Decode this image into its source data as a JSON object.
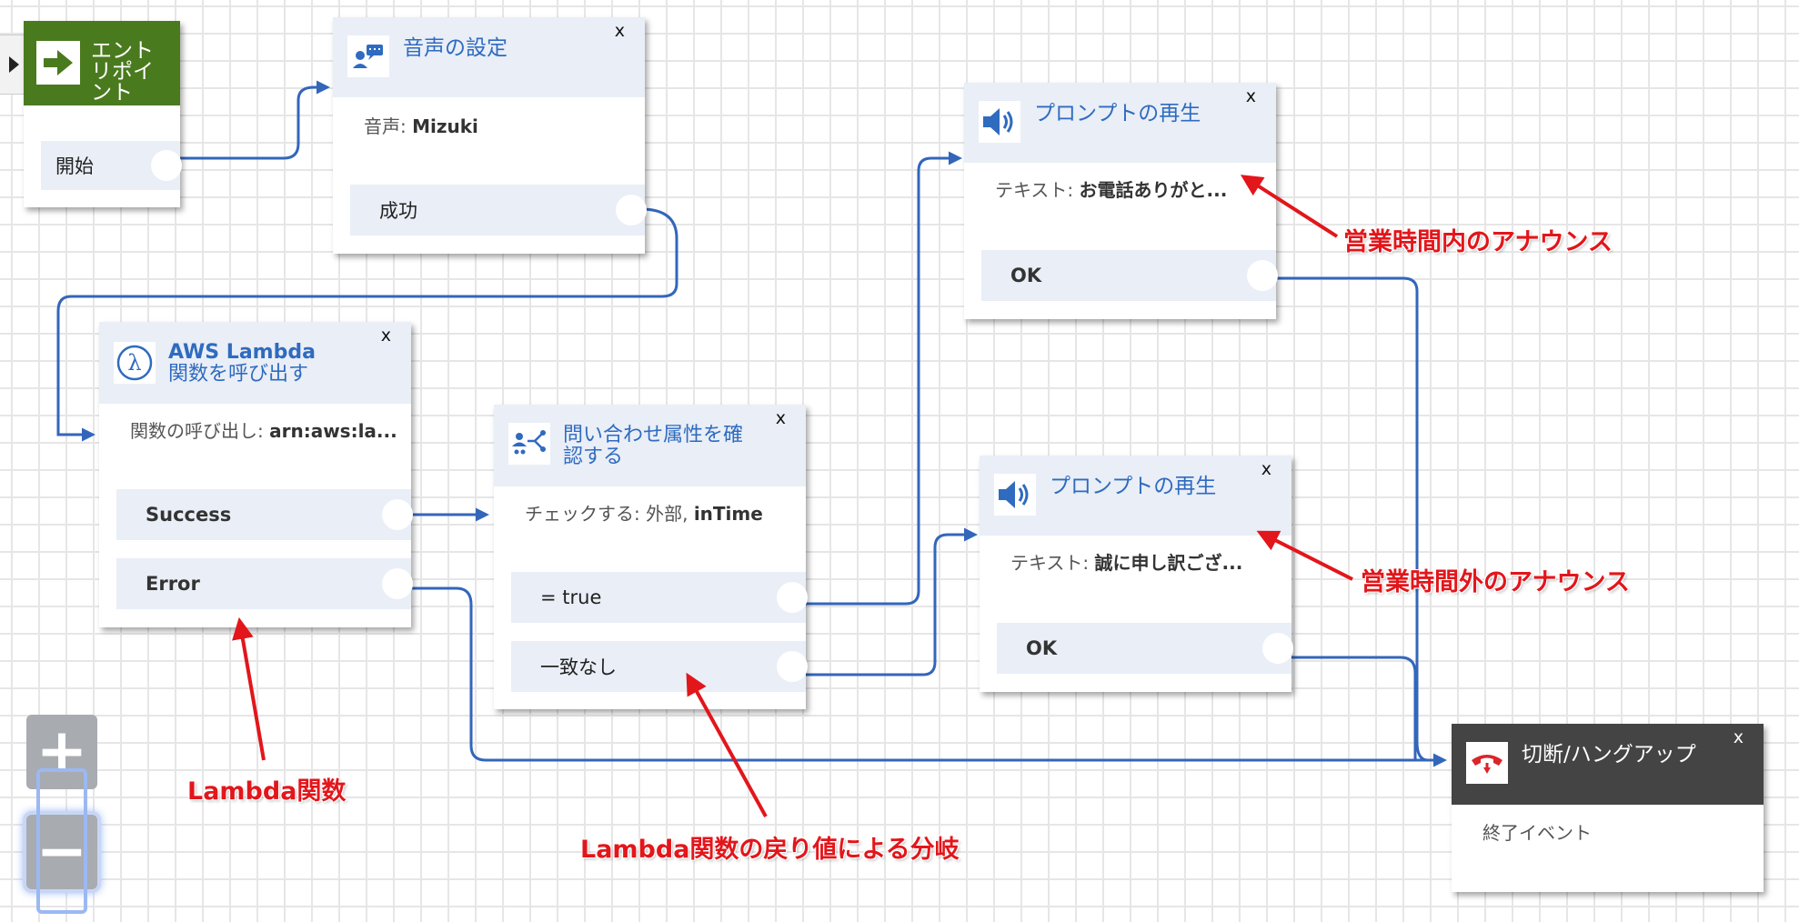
{
  "entry": {
    "title": "エントリポイント",
    "start_label": "開始"
  },
  "voice": {
    "title": "音声の設定",
    "desc_prefix": "音声: ",
    "desc_value": "Mizuki",
    "branch_success": "成功",
    "close": "x"
  },
  "lambda": {
    "title_line1": "AWS Lambda",
    "title_line2": "関数を呼び出す",
    "desc_prefix": "関数の呼び出し: ",
    "desc_value": "arn:aws:la...",
    "branch_success": "Success",
    "branch_error": "Error",
    "close": "x"
  },
  "check": {
    "title_line1": "問い合わせ属性を確",
    "title_line2": "認する",
    "desc_prefix": "チェックする: 外部, ",
    "desc_value": "inTime",
    "branch_true": "= true",
    "branch_nomatch": "一致なし",
    "close": "x"
  },
  "prompt1": {
    "title": "プロンプトの再生",
    "desc_prefix": "テキスト: ",
    "desc_value": "お電話ありがと...",
    "branch_ok": "OK",
    "close": "x"
  },
  "prompt2": {
    "title": "プロンプトの再生",
    "desc_prefix": "テキスト: ",
    "desc_value": "誠に申し訳ござ...",
    "branch_ok": "OK",
    "close": "x"
  },
  "hangup": {
    "title": "切断/ハングアップ",
    "desc": "終了イベント",
    "close": "x"
  },
  "annotations": {
    "in_hours": "営業時間内のアナウンス",
    "out_hours": "営業時間外のアナウンス",
    "lambda_fn": "Lambda関数",
    "lambda_branch": "Lambda関数の戻り値による分岐"
  },
  "zoom": {
    "in_label": "+",
    "out_label": "−"
  },
  "colors": {
    "connector": "#3366bb",
    "title_blue": "#2f6bbf",
    "entry_green": "#4a7a1e",
    "hangup_dark": "#444444",
    "annotation_red": "#e2161b"
  }
}
